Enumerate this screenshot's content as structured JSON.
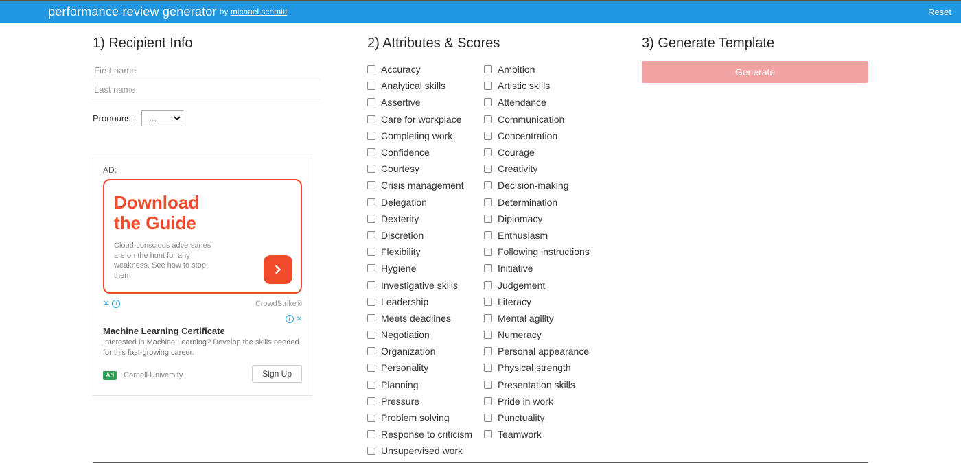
{
  "header": {
    "title": "performance review generator",
    "by_prefix": "by ",
    "author": "michael schmitt",
    "reset_label": "Reset"
  },
  "sections": {
    "recipient_title": "1) Recipient Info",
    "attributes_title": "2) Attributes & Scores",
    "generate_title": "3) Generate Template"
  },
  "recipient": {
    "first_name_placeholder": "First name",
    "last_name_placeholder": "Last name",
    "pronouns_label": "Pronouns:",
    "pronouns_value": "..."
  },
  "ad1": {
    "label": "AD:",
    "headline1": "Download",
    "headline2": "the Guide",
    "sub": "Cloud-conscious adversaries are on the hunt for any weakness. See how to stop them",
    "brand": "CrowdStrike®"
  },
  "ad2": {
    "title": "Machine Learning Certificate",
    "desc": "Interested in Machine Learning? Develop the skills needed for this fast-growing career.",
    "ad_badge": "Ad",
    "source": "Cornell University",
    "cta": "Sign Up"
  },
  "attributes": {
    "col1": [
      "Accuracy",
      "Analytical skills",
      "Assertive",
      "Care for workplace",
      "Completing work",
      "Confidence",
      "Courtesy",
      "Crisis management",
      "Delegation",
      "Dexterity",
      "Discretion",
      "Flexibility",
      "Hygiene",
      "Investigative skills",
      "Leadership",
      "Meets deadlines",
      "Negotiation",
      "Organization",
      "Personality",
      "Planning",
      "Pressure",
      "Problem solving",
      "Response to criticism",
      "Unsupervised work"
    ],
    "col2": [
      "Ambition",
      "Artistic skills",
      "Attendance",
      "Communication",
      "Concentration",
      "Courage",
      "Creativity",
      "Decision-making",
      "Determination",
      "Diplomacy",
      "Enthusiasm",
      "Following instructions",
      "Initiative",
      "Judgement",
      "Literacy",
      "Mental agility",
      "Numeracy",
      "Personal appearance",
      "Physical strength",
      "Presentation skills",
      "Pride in work",
      "Punctuality",
      "Teamwork"
    ]
  },
  "generate_button": "Generate"
}
